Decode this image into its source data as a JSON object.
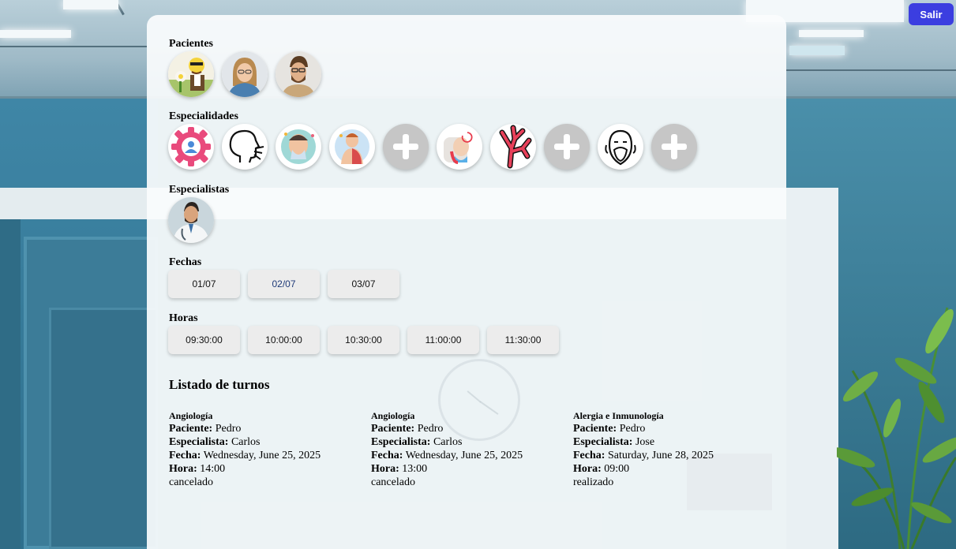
{
  "header": {
    "logout_label": "Salir"
  },
  "pacientes": {
    "title": "Pacientes",
    "items": [
      {
        "icon": "cartoon-patient-avatar"
      },
      {
        "icon": "woman-patient-avatar"
      },
      {
        "icon": "man-patient-avatar"
      }
    ]
  },
  "especialidades": {
    "title": "Especialidades",
    "items": [
      {
        "icon": "gear-person-icon"
      },
      {
        "icon": "head-sneeze-icon"
      },
      {
        "icon": "allergy-face-icon"
      },
      {
        "icon": "anatomy-icon"
      },
      {
        "icon": "plus-icon"
      },
      {
        "icon": "elderly-icon"
      },
      {
        "icon": "vein-icon"
      },
      {
        "icon": "plus-icon"
      },
      {
        "icon": "old-man-face-icon"
      },
      {
        "icon": "plus-icon"
      }
    ]
  },
  "especialistas": {
    "title": "Especialistas",
    "items": [
      {
        "icon": "doctor-avatar"
      }
    ]
  },
  "fechas": {
    "title": "Fechas",
    "items": [
      "01/07",
      "02/07",
      "03/07"
    ],
    "selected": "02/07"
  },
  "horas": {
    "title": "Horas",
    "items": [
      "09:30:00",
      "10:00:00",
      "10:30:00",
      "11:00:00",
      "11:30:00"
    ]
  },
  "listado": {
    "title": "Listado de turnos",
    "labels": {
      "paciente": "Paciente:",
      "especialista": "Especialista:",
      "fecha": "Fecha:",
      "hora": "Hora:"
    },
    "turnos": [
      {
        "especialidad": "Angiología",
        "paciente": "Pedro",
        "especialista": "Carlos",
        "fecha": "Wednesday, June 25, 2025",
        "hora": "14:00",
        "estado": "cancelado"
      },
      {
        "especialidad": "Angiología",
        "paciente": "Pedro",
        "especialista": "Carlos",
        "fecha": "Wednesday, June 25, 2025",
        "hora": "13:00",
        "estado": "cancelado"
      },
      {
        "especialidad": "Alergia e Inmunología",
        "paciente": "Pedro",
        "especialista": "Jose",
        "fecha": "Saturday, June 28, 2025",
        "hora": "09:00",
        "estado": "realizado"
      }
    ]
  }
}
